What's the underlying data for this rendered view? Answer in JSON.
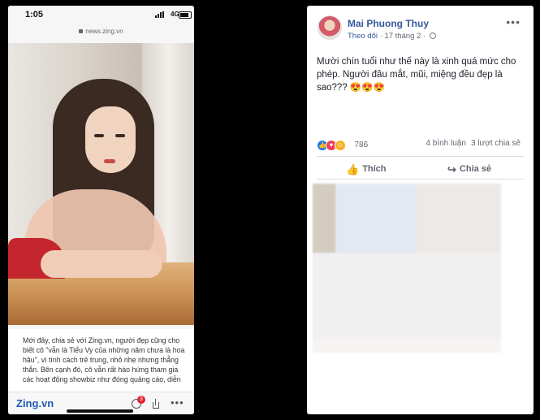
{
  "phone": {
    "status": {
      "time": "1:05",
      "network": "4G"
    },
    "url": "news.zing.vn",
    "article_text": "Mới đây, chia sẻ với Zing.vn, người đẹp cũng cho biết cô \"vẫn là Tiểu Vy của những năm chưa là hoa hậu\", vì tính cách trẻ trung, nhỏ nhẹ nhưng thẳng thắn. Bên cạnh đó, cô vẫn rất hào hứng tham gia các hoạt động showbiz như đóng quảng cáo, diễn",
    "bottom_bar": {
      "brand": "Zing",
      "brand_suffix": ".vn",
      "comment_badge": "3",
      "more": "•••"
    }
  },
  "post": {
    "author": "Mai Phuong Thuy",
    "follow_label": "Theo dõi",
    "date": "17 tháng 2",
    "more": "•••",
    "text": "Mười chín tuổi như thế này là xinh quá mức cho phép. Người đâu mắt, mũi, miệng đều đẹp là sao??? 😍😍😍",
    "reaction_count": "786",
    "comments": "4 bình luận",
    "shares": "3 lượt chia sẻ",
    "actions": {
      "like": "Thích",
      "share": "Chia sẻ"
    }
  },
  "colors": {
    "fb_blue": "#365899",
    "zing_blue": "#1e5ab8",
    "badge_red": "#e0252b"
  }
}
